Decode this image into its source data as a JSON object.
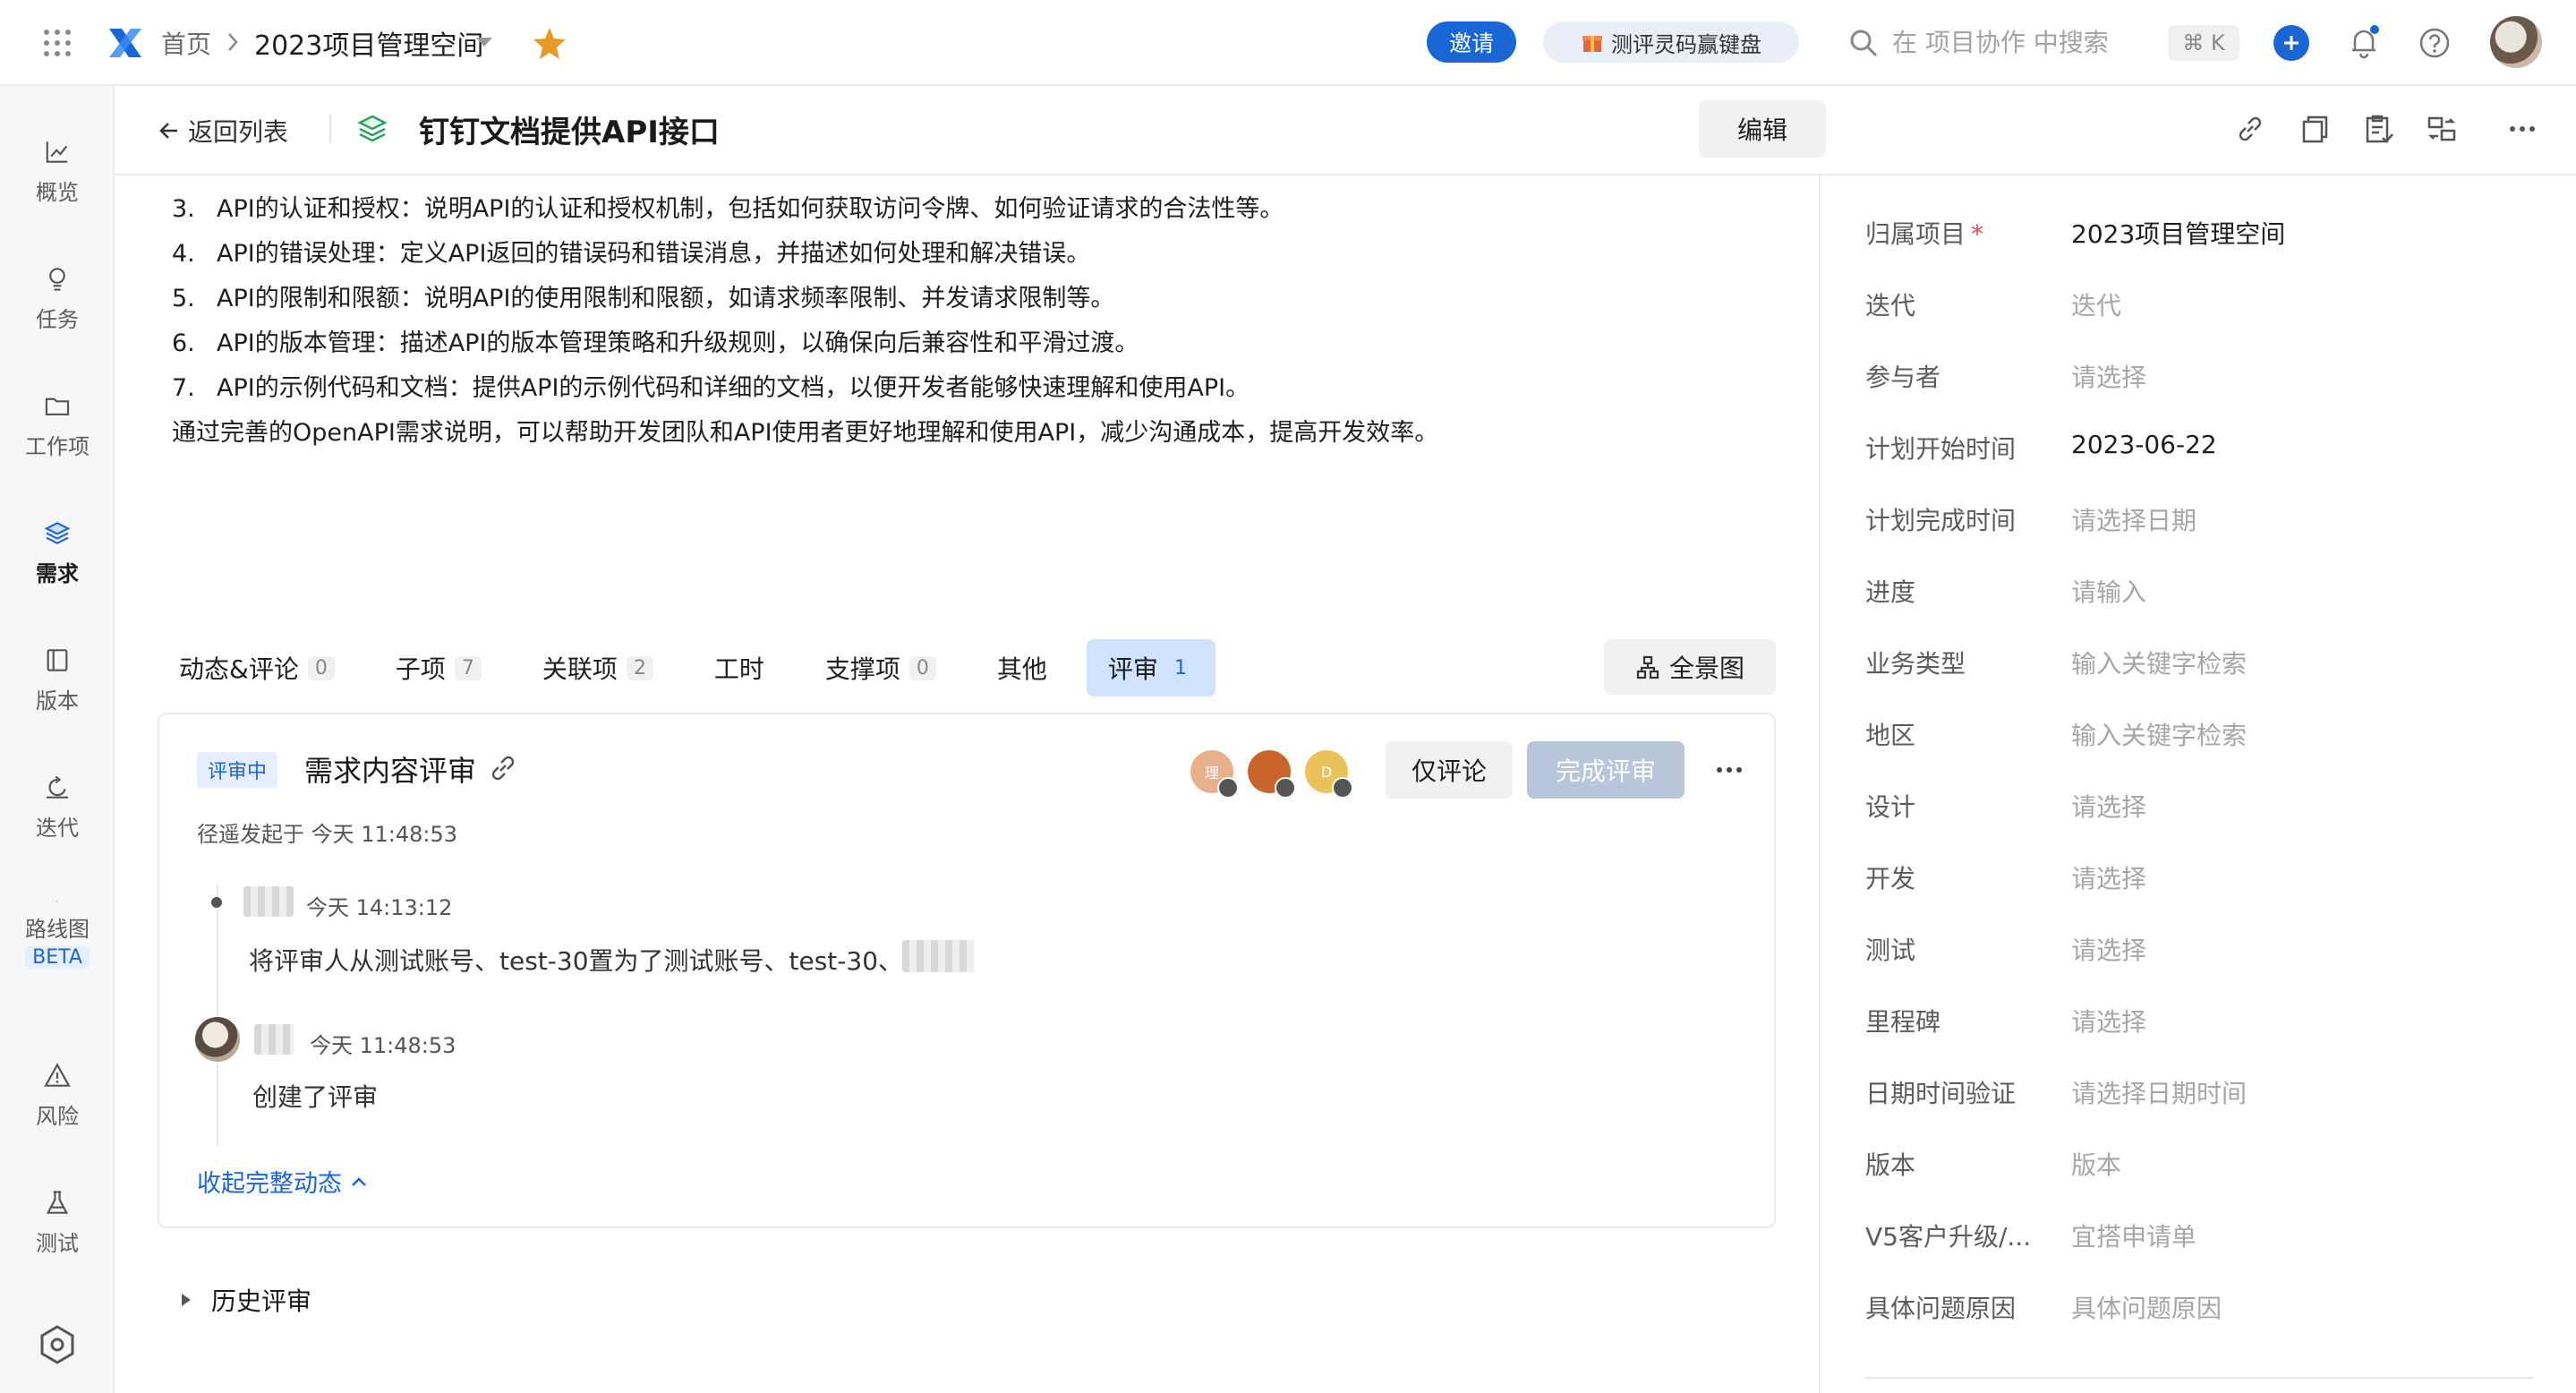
{
  "topbar": {
    "breadcrumb_home": "首页",
    "space_name": "2023项目管理空间",
    "invite_label": "邀请",
    "promo_label": "测评灵码赢键盘",
    "search_placeholder": "在 项目协作 中搜索",
    "shortcut": "⌘ K",
    "accent": "#1a66d6"
  },
  "leftnav": {
    "items": [
      {
        "label": "概览",
        "icon": "chart-line-icon"
      },
      {
        "label": "任务",
        "icon": "bulb-icon"
      },
      {
        "label": "工作项",
        "icon": "folder-icon"
      },
      {
        "label": "需求",
        "icon": "layers-icon"
      },
      {
        "label": "版本",
        "icon": "book-icon"
      },
      {
        "label": "迭代",
        "icon": "cycle-icon"
      },
      {
        "label": "路线图",
        "icon": "roadmap-icon",
        "badge": "BETA"
      },
      {
        "label": "风险",
        "icon": "warning-icon"
      },
      {
        "label": "测试",
        "icon": "flask-icon"
      }
    ],
    "active": "需求"
  },
  "header": {
    "back_label": "返回列表",
    "title": "钉钉文档提供API接口",
    "edit_label": "编辑"
  },
  "description": {
    "items": [
      {
        "num": "3.",
        "text": "API的认证和授权：说明API的认证和授权机制，包括如何获取访问令牌、如何验证请求的合法性等。"
      },
      {
        "num": "4.",
        "text": "API的错误处理：定义API返回的错误码和错误消息，并描述如何处理和解决错误。"
      },
      {
        "num": "5.",
        "text": "API的限制和限额：说明API的使用限制和限额，如请求频率限制、并发请求限制等。"
      },
      {
        "num": "6.",
        "text": "API的版本管理：描述API的版本管理策略和升级规则，以确保向后兼容性和平滑过渡。"
      },
      {
        "num": "7.",
        "text": "API的示例代码和文档：提供API的示例代码和详细的文档，以便开发者能够快速理解和使用API。"
      }
    ],
    "summary": "通过完善的OpenAPI需求说明，可以帮助开发团队和API使用者更好地理解和使用API，减少沟通成本，提高开发效率。"
  },
  "tabs": [
    {
      "label": "动态&评论",
      "count": "0"
    },
    {
      "label": "子项",
      "count": "7"
    },
    {
      "label": "关联项",
      "count": "2"
    },
    {
      "label": "工时",
      "count": ""
    },
    {
      "label": "支撑项",
      "count": "0"
    },
    {
      "label": "其他",
      "count": ""
    },
    {
      "label": "评审",
      "count": "1"
    }
  ],
  "active_tab": "评审",
  "overview_label": "全景图",
  "review": {
    "status": "评审中",
    "title": "需求内容评审",
    "avatars": [
      {
        "text": "理",
        "color": "#e8b08a"
      },
      {
        "text": "",
        "color": "#c9652a"
      },
      {
        "text": "D",
        "color": "#e9c35a"
      }
    ],
    "comment_only_label": "仅评论",
    "complete_label": "完成评审",
    "initiated": "径遥发起于 今天 11:48:53",
    "events": [
      {
        "time": "今天 14:13:12",
        "text": "将评审人从测试账号、test-30置为了测试账号、test-30、"
      },
      {
        "time": "今天 11:48:53",
        "text": "创建了评审"
      }
    ],
    "collapse_label": "收起完整动态"
  },
  "history_label": "历史评审",
  "fields": [
    {
      "label": "归属项目",
      "required": true,
      "value": "2023项目管理空间",
      "filled": true
    },
    {
      "label": "迭代",
      "value": "迭代",
      "filled": false
    },
    {
      "label": "参与者",
      "value": "请选择",
      "filled": false
    },
    {
      "label": "计划开始时间",
      "value": "2023-06-22",
      "filled": true
    },
    {
      "label": "计划完成时间",
      "value": "请选择日期",
      "filled": false
    },
    {
      "label": "进度",
      "value": "请输入",
      "filled": false
    },
    {
      "label": "业务类型",
      "value": "输入关键字检索",
      "filled": false
    },
    {
      "label": "地区",
      "value": "输入关键字检索",
      "filled": false
    },
    {
      "label": "设计",
      "value": "请选择",
      "filled": false
    },
    {
      "label": "开发",
      "value": "请选择",
      "filled": false
    },
    {
      "label": "测试",
      "value": "请选择",
      "filled": false
    },
    {
      "label": "里程碑",
      "value": "请选择",
      "filled": false
    },
    {
      "label": "日期时间验证",
      "value": "请选择日期时间",
      "filled": false
    },
    {
      "label": "版本",
      "value": "版本",
      "filled": false
    },
    {
      "label": "V5客户升级/...",
      "value": "宜搭申请单",
      "filled": false
    },
    {
      "label": "具体问题原因",
      "value": "具体问题原因",
      "filled": false
    }
  ]
}
